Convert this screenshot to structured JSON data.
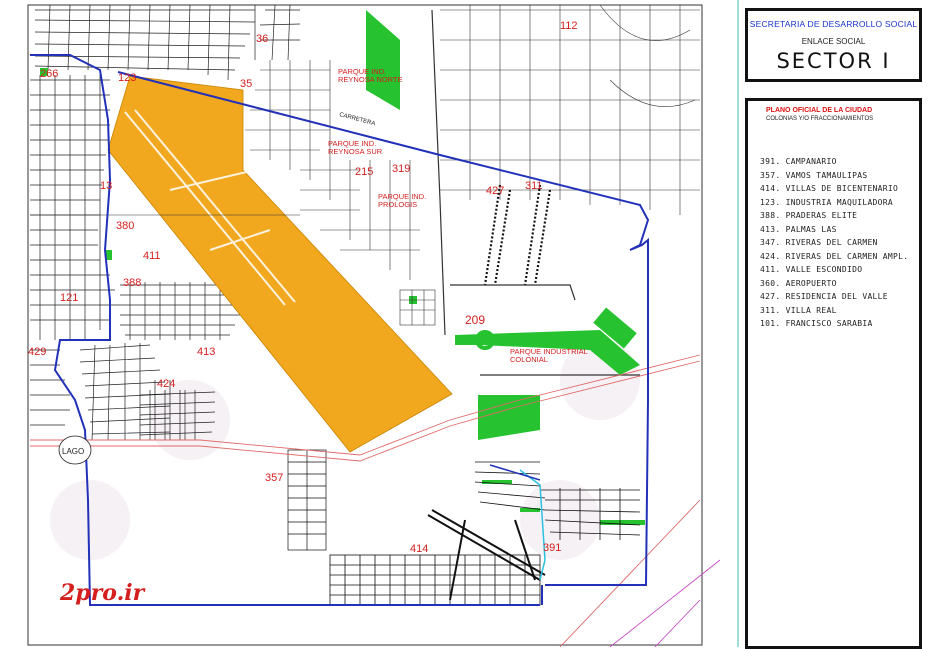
{
  "title_block": {
    "ministry": "SECRETARIA DE DESARROLLO SOCIAL",
    "department": "ENLACE SOCIAL",
    "sector": "SECTOR I"
  },
  "legend": {
    "title": "PLANO OFICIAL DE LA CIUDAD",
    "subtitle": "COLONIAS Y/O   FRACCIONAMIENTOS",
    "items": [
      "391. CAMPANARIO",
      "357. VAMOS TAMAULIPAS",
      "414. VILLAS DE BICENTENARIO",
      "123. INDUSTRIA MAQUILADORA",
      "388. PRADERAS ELITE",
      "413. PALMAS LAS",
      "347. RIVERAS DEL CARMEN",
      "424. RIVERAS DEL CARMEN AMPL.",
      "411. VALLE ESCONDIDO",
      "360. AEROPUERTO",
      "427. RESIDENCIA DEL VALLE",
      "311. VILLA REAL",
      "101. FRANCISCO SARABIA"
    ]
  },
  "map_labels": {
    "n112": "112",
    "n365": "36",
    "n35": "35",
    "n215": "215",
    "n319": "319",
    "n427": "427",
    "n311": "311",
    "n380": "380",
    "n411": "411",
    "n388": "388",
    "n209": "209",
    "n413": "413",
    "n424": "424",
    "n429": "429",
    "n357": "357",
    "n414": "414",
    "n391": "391",
    "n13": "13",
    "n266": "266",
    "n123": "123",
    "n121": "121",
    "parque_norte": "PARQUE IND. REYNOSA NORTE",
    "parque_sur": "PARQUE IND. REYNOSA SUR",
    "parque_prologis": "PARQUE IND. PROLOGIS",
    "parque_colonial": "PARQUE INDUSTRIAL COLONIAL",
    "lago": "LAGO",
    "carretera": "CARRETERA",
    "watermark": "2pro.ir"
  },
  "colors": {
    "airport": "#f2a81e",
    "boundary": "#2231b8",
    "label": "#d41f1f",
    "green_area": "#27c22f",
    "street": "#222222"
  }
}
